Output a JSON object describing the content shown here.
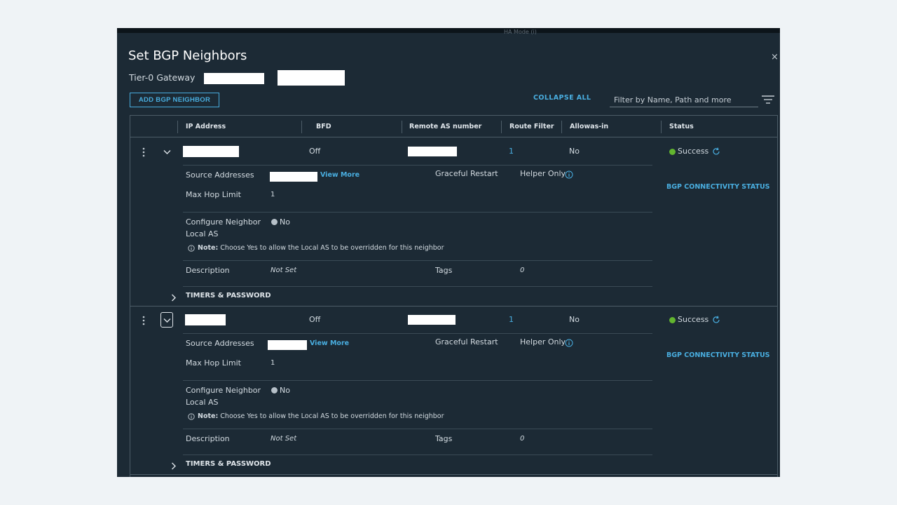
{
  "background_strip": {
    "ghost_text": "HA Mode  (i)"
  },
  "dialog": {
    "title": "Set BGP Neighbors",
    "close_glyph": "×",
    "gateway_label": "Tier-0 Gateway",
    "add_button": "ADD BGP NEIGHBOR",
    "collapse_all": "COLLAPSE ALL",
    "filter_placeholder": "Filter by Name, Path and more"
  },
  "columns": [
    "IP Address",
    "BFD",
    "Remote AS number",
    "Route Filter",
    "Allowas-in",
    "Status"
  ],
  "labels": {
    "source_addresses": "Source Addresses",
    "view_more": "View More",
    "graceful_restart": "Graceful Restart",
    "max_hop_limit": "Max Hop Limit",
    "configure_neighbor_line1": "Configure Neighbor",
    "configure_neighbor_line2": "Local AS",
    "note_bold": "Note:",
    "note_text": "Choose Yes to allow the Local AS to be overridden for this neighbor",
    "description": "Description",
    "tags": "Tags",
    "timers_password": "TIMERS & PASSWORD",
    "bgp_connectivity_status": "BGP CONNECTIVITY STATUS"
  },
  "neighbors": [
    {
      "bfd": "Off",
      "route_filter": "1",
      "allowas_in": "No",
      "status": "Success",
      "graceful_restart": "Helper Only",
      "max_hop_limit": "1",
      "local_as": "No",
      "description": "Not Set",
      "tags": "0"
    },
    {
      "bfd": "Off",
      "route_filter": "1",
      "allowas_in": "No",
      "status": "Success",
      "graceful_restart": "Helper Only",
      "max_hop_limit": "1",
      "local_as": "No",
      "description": "Not Set",
      "tags": "0"
    }
  ],
  "colors": {
    "panel": "#1c2a35",
    "accent": "#49aee0",
    "success": "#62b52f",
    "border": "#4d5d68"
  }
}
